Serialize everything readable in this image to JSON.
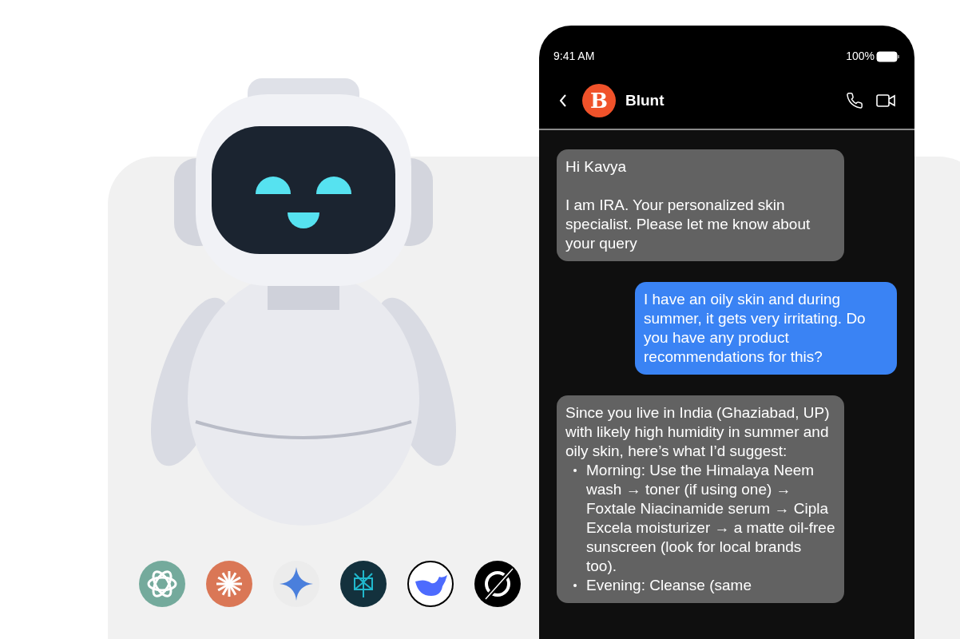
{
  "status_bar": {
    "time": "9:41 AM",
    "battery": "100%"
  },
  "chat_header": {
    "avatar_letter": "B",
    "name": "Blunt"
  },
  "messages": [
    {
      "kind": "incoming",
      "paragraphs": [
        "Hi Kavya",
        "I am IRA. Your personalized skin specialist. Please let me know about your query"
      ]
    },
    {
      "kind": "outgoing",
      "paragraphs": [
        "I have an oily skin and during summer, it gets very irritating. Do you have any product recommendations for this?"
      ]
    },
    {
      "kind": "incoming",
      "paragraphs": [
        "Since you live in India (Ghaziabad, UP) with likely high humidity in summer and oily skin, here’s what I’d suggest:"
      ],
      "bullets": [
        "Morning: Use the Himalaya Neem wash → toner (if using one) → Foxtale Niacinamide serum → Cipla Excela moisturizer → a matte oil-free sunscreen (look for local brands too).",
        "Evening: Cleanse (same"
      ]
    }
  ]
}
